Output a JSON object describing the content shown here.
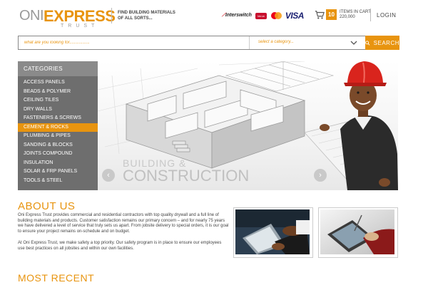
{
  "header": {
    "logo": {
      "oni": "ONI",
      "express": "EXPRESS",
      "trust": "TRUST"
    },
    "tagline": "FIND BUILDING MATERIALS OF ALL SORTS...",
    "payments": {
      "interswitch": "Interswitch",
      "verve": "Verve",
      "mastercard": "MasterCard",
      "visa": "VISA"
    },
    "cart": {
      "count": "10",
      "label": "ITEMS IN CART",
      "total": "220,000"
    },
    "login": "LOGIN"
  },
  "search": {
    "placeholder": "what are you looking for.................",
    "category_placeholder": "select a category...",
    "button_label": "SEARCH"
  },
  "sidebar": {
    "title": "CATEGORIES",
    "items": [
      {
        "label": "ACCESS PANELS"
      },
      {
        "label": "BEADS & POLYMER"
      },
      {
        "label": "CEILING TILES"
      },
      {
        "label": "DRY WALLS"
      },
      {
        "label": "FASTENERS & SCREWS"
      },
      {
        "label": "CEMENT & ROCKS",
        "active": true
      },
      {
        "label": "PLUMBING & PIPES"
      },
      {
        "label": "SANDING & BLOCKS"
      },
      {
        "label": "JOINTS COMPOUND"
      },
      {
        "label": "INSULATION"
      },
      {
        "label": "SOLAR & FRP PANELS"
      },
      {
        "label": "TOOLS & STEEL"
      }
    ]
  },
  "hero": {
    "caption_line1": "BUILDING &",
    "caption_line2": "CONSTRUCTION",
    "prev_icon": "chevron-left-icon",
    "next_icon": "chevron-right-icon"
  },
  "about": {
    "title": "ABOUT US",
    "paragraph1": "Oni Express Trust provides commercial and residential contractors with top quality drywall and a full line of building materials and products.  Customer satisfaction remains our primary concern – and for nearly 75 years we have delivered a level of service that truly sets us apart. From jobsite delivery to special orders, it is our goal to ensure your project remains on-schedule and on budget.",
    "paragraph2": "At Oni Express Trust, we make safety a top priority. Our safety program is in place to ensure our employees use best practices on all jobsites and within our own facilities."
  },
  "most_recent": {
    "title": "MOST RECENT"
  },
  "colors": {
    "accent": "#e8940f",
    "sidebar_bg": "#6e6e6e",
    "sidebar_header": "#8a8a8a",
    "active_category": "#e8940f"
  }
}
